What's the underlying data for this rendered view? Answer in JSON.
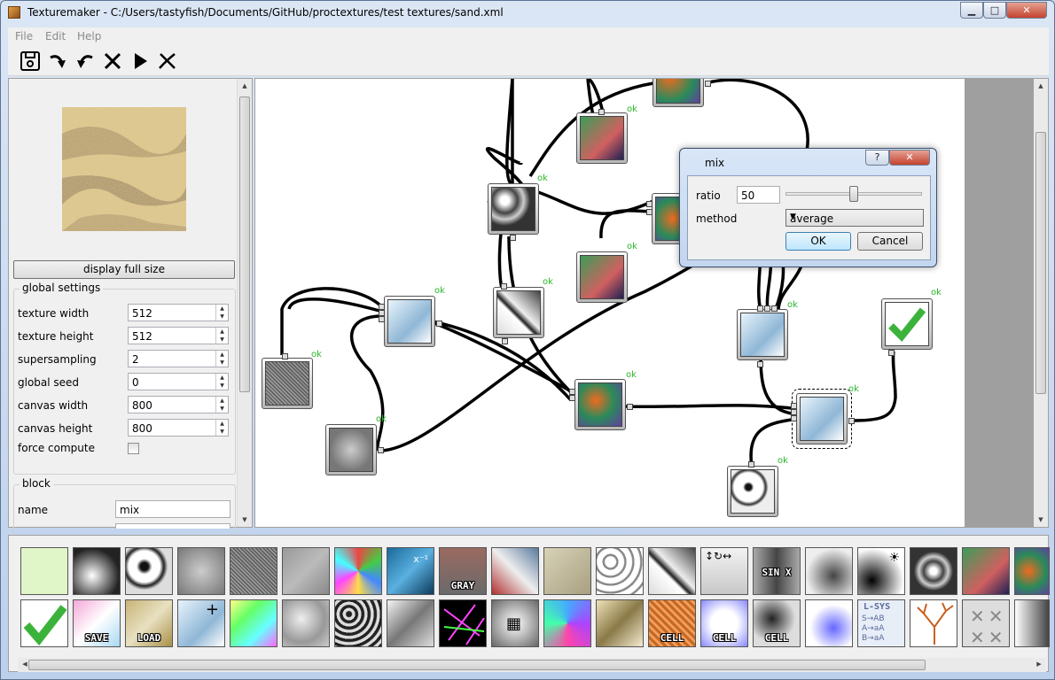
{
  "window": {
    "title": "Texturemaker - C:/Users/tastyfish/Documents/GitHub/proctextures/test textures/sand.xml",
    "min_label": "▁",
    "max_label": "□",
    "close_label": "✕"
  },
  "menu": [
    "File",
    "Edit",
    "Help"
  ],
  "toolbar": [
    "save-icon",
    "redo-icon",
    "undo-icon",
    "delete-icon",
    "run-icon",
    "disconnect-icon"
  ],
  "preview": {
    "button_label": "display full size"
  },
  "global_settings": {
    "title": "global settings",
    "fields": [
      {
        "label": "texture width",
        "value": "512"
      },
      {
        "label": "texture height",
        "value": "512"
      },
      {
        "label": "supersampling",
        "value": "2"
      },
      {
        "label": "global seed",
        "value": "0"
      },
      {
        "label": "canvas width",
        "value": "800"
      },
      {
        "label": "canvas height",
        "value": "800"
      }
    ],
    "force_label": "force compute",
    "force_checked": false
  },
  "block": {
    "title": "block",
    "name_label": "name",
    "name_value": "mix"
  },
  "node_status": "ok",
  "dialog": {
    "title": "mix",
    "help_label": "?",
    "close_label": "✕",
    "ratio_label": "ratio",
    "ratio_value": "50",
    "ratio_slider_level_percent": 50,
    "method_label": "method",
    "method_value": "average",
    "ok_label": "OK",
    "cancel_label": "Cancel"
  },
  "palette_labels": {
    "gray": "GRAY",
    "save": "SAVE",
    "load": "LOAD",
    "cell": "CELL",
    "sinx": "SIN X",
    "lsys": "L-SYS"
  },
  "colors": {
    "status_ok": "#2bb52b",
    "canvas_margin": "#9f9f9f"
  }
}
